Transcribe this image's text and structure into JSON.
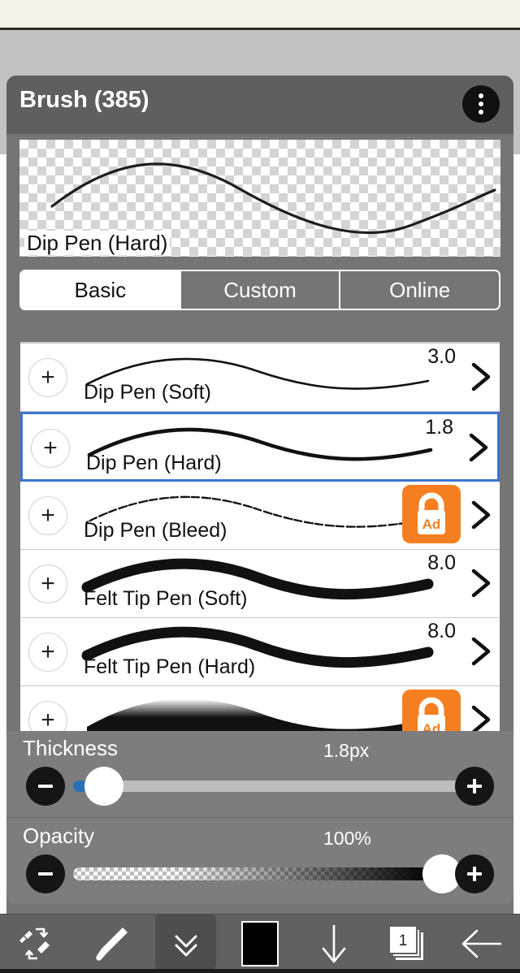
{
  "app": {
    "panel_title": "Brush (385)",
    "menu_icon": "kebab-menu-icon"
  },
  "preview": {
    "brush_name": "Dip Pen (Hard)",
    "background": "transparent-checkerboard"
  },
  "tabs": [
    {
      "label": "Basic",
      "active": true
    },
    {
      "label": "Custom",
      "active": false
    },
    {
      "label": "Online",
      "active": false
    }
  ],
  "brush_list": [
    {
      "name": "Dip Pen (Soft)",
      "size": "3.0",
      "locked": false,
      "selected": false,
      "stroke": "thin-taper"
    },
    {
      "name": "Dip Pen (Hard)",
      "size": "1.8",
      "locked": false,
      "selected": true,
      "stroke": "medium-taper"
    },
    {
      "name": "Dip Pen (Bleed)",
      "size": "",
      "locked": true,
      "selected": false,
      "stroke": "speckled"
    },
    {
      "name": "Felt Tip Pen (Soft)",
      "size": "8.0",
      "locked": false,
      "selected": false,
      "stroke": "thick"
    },
    {
      "name": "Felt Tip Pen (Hard)",
      "size": "8.0",
      "locked": false,
      "selected": false,
      "stroke": "thick"
    },
    {
      "name": "",
      "size": "",
      "locked": true,
      "selected": false,
      "stroke": "airbrush"
    }
  ],
  "badge": {
    "label": "Ad",
    "color": "#F57F20"
  },
  "thickness": {
    "label": "Thickness",
    "value": "1.8px",
    "minus_label": "minus-icon",
    "plus_label": "plus-icon",
    "fill_color": "#2c6fb5",
    "thumb_percent": 5
  },
  "opacity": {
    "label": "Opacity",
    "value": "100%",
    "minus_label": "minus-icon",
    "plus_label": "plus-icon",
    "thumb_percent": 100
  },
  "toolbar": {
    "items": [
      {
        "name": "swap-pen-eraser",
        "icon": "pen-eraser-swap-icon",
        "active": false
      },
      {
        "name": "brush-tool",
        "icon": "brush-icon",
        "active": false
      },
      {
        "name": "collapse-panel",
        "icon": "double-chevron-down-icon",
        "active": true
      },
      {
        "name": "color-swatch",
        "icon": "color-swatch-black",
        "active": false
      },
      {
        "name": "download",
        "icon": "arrow-down-icon",
        "active": false
      },
      {
        "name": "layers",
        "icon": "layers-icon",
        "active": false
      },
      {
        "name": "back",
        "icon": "arrow-left-icon",
        "active": false
      }
    ],
    "layer_count": "1"
  },
  "colors": {
    "panel_bg": "#757575",
    "header_bg": "#5f5f5f",
    "slider_bg": "#7d7d7d",
    "toolbar_bg": "#616161",
    "selection_border": "#3d74d0",
    "accent_orange": "#F57F20"
  }
}
